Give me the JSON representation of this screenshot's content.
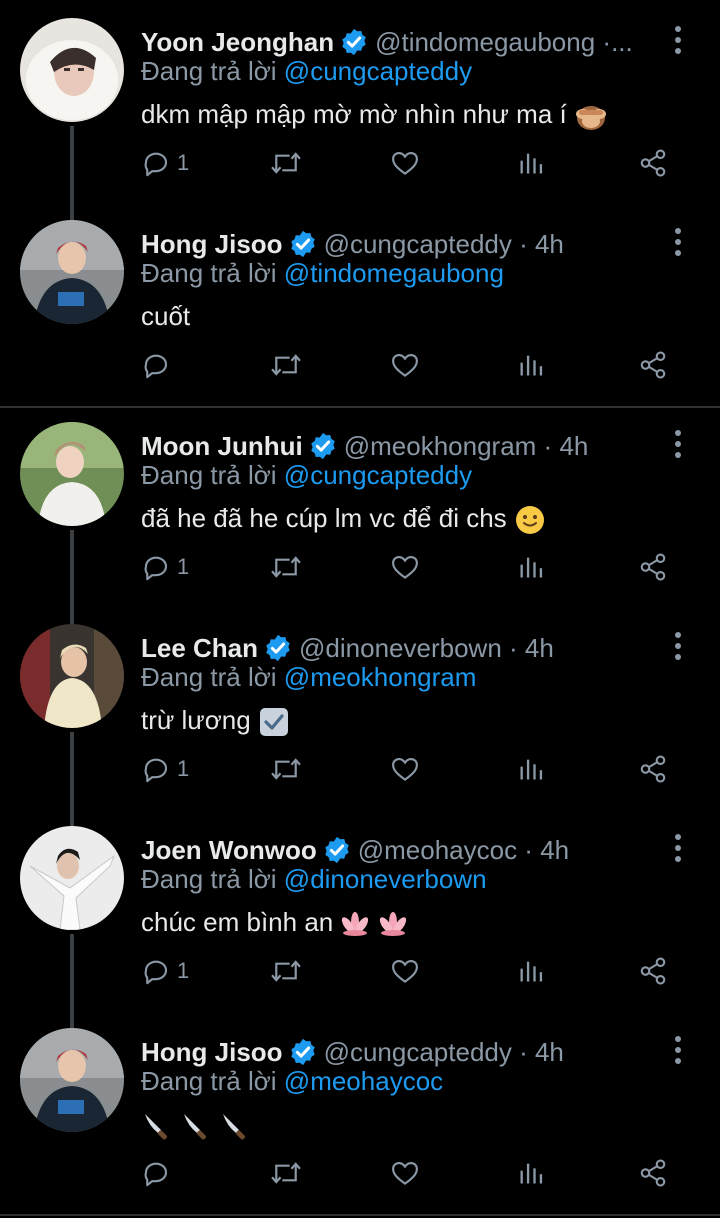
{
  "colors": {
    "background": "#000000",
    "text": "#e7e9ea",
    "muted": "#8b98a5",
    "link": "#1d9bf0",
    "verified": "#1d9bf0",
    "thread_line": "#3b4045"
  },
  "reply_prefix": "Đang trả lời",
  "tweets": [
    {
      "name": "Yoon Jeonghan",
      "verified": true,
      "handle": "@tindomegaubong ·...",
      "reply_to": "@cungcapteddy",
      "text": "dkm mập mập mờ mờ nhìn như ma í",
      "emoji": "see-no-evil-monkey",
      "reply_count": "1"
    },
    {
      "name": "Hong Jisoo",
      "verified": true,
      "handle": "@cungcapteddy · 4h",
      "reply_to": "@tindomegaubong",
      "text": "cuốt",
      "emoji": "",
      "reply_count": ""
    },
    {
      "name": "Moon Junhui",
      "verified": true,
      "handle": "@meokhongram · 4h",
      "reply_to": "@cungcapteddy",
      "text": "đã he đã he cúp lm vc để đi chs",
      "emoji": "slightly-smiling-face",
      "reply_count": "1"
    },
    {
      "name": "Lee Chan",
      "verified": true,
      "handle": "@dinoneverbown · 4h",
      "reply_to": "@meokhongram",
      "text": "trừ lương",
      "emoji": "check-box",
      "reply_count": "1"
    },
    {
      "name": "Joen Wonwoo",
      "verified": true,
      "handle": "@meohaycoc · 4h",
      "reply_to": "@dinoneverbown",
      "text": "chúc em bình an",
      "emoji": "lotus-lotus",
      "reply_count": "1"
    },
    {
      "name": "Hong Jisoo",
      "verified": true,
      "handle": "@cungcapteddy · 4h",
      "reply_to": "@meohaycoc",
      "text": "",
      "emoji": "knife-knife-knife",
      "reply_count": ""
    }
  ]
}
